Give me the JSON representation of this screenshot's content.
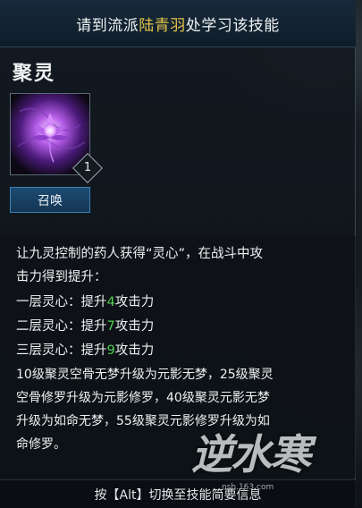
{
  "header": {
    "prefix": "请到流派",
    "teacher": "陆青羽",
    "suffix": "处学习该技能"
  },
  "skill": {
    "name": "聚灵",
    "icon": "purple-lotus-spirit-icon",
    "level": "1",
    "type_tag": "召唤"
  },
  "description": {
    "lines": [
      "让九灵控制的药人获得“灵心”，在战斗中攻",
      "击力得到提升：",
      "一层灵心：提升",
      "二层灵心：提升",
      "三层灵心：提升",
      "10级聚灵空骨无梦升级为元影无梦，25级聚灵",
      "空骨修罗升级为元影修罗，40级聚灵元影无梦",
      "升级为如命无梦，55级聚灵元影修罗升级为如",
      "命修罗。"
    ],
    "tiers": [
      {
        "label": "一层灵心：提升",
        "value": "4",
        "unit": "攻击力"
      },
      {
        "label": "二层灵心：提升",
        "value": "7",
        "unit": "攻击力"
      },
      {
        "label": "三层灵心：提升",
        "value": "9",
        "unit": "攻击力"
      }
    ]
  },
  "footer": {
    "hint": "按【Alt】切换至技能简要信息"
  },
  "watermark": {
    "text": "逆水寒",
    "url": "nsh.163.com"
  },
  "colors": {
    "highlight_name": "#e3c24a",
    "tier_value": "#4fd04f",
    "tag_bg": "#1d4b72"
  }
}
